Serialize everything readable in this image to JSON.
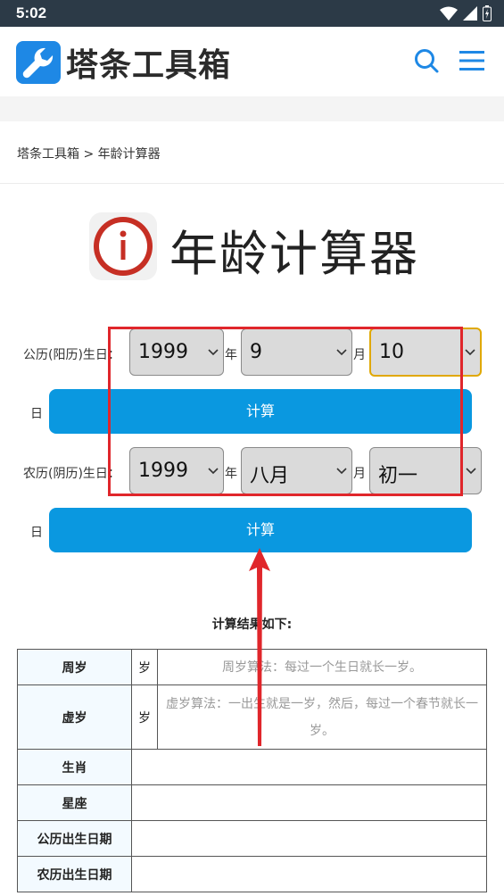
{
  "status": {
    "time": "5:02"
  },
  "header": {
    "logo_text": "塔条工具箱"
  },
  "breadcrumb": {
    "text": "塔条工具箱 > 年龄计算器"
  },
  "page": {
    "title": "年龄计算器"
  },
  "solar": {
    "label": "公历(阳历)生日：",
    "year": "1999",
    "year_unit": "年",
    "month": "9",
    "month_unit": "月",
    "day": "10",
    "day_unit": "日",
    "button": "计算"
  },
  "lunar": {
    "label": "农历(阴历)生日：",
    "year": "1999",
    "year_unit": "年",
    "month": "八月",
    "month_unit": "月",
    "day": "初一",
    "day_unit": "日",
    "button": "计算"
  },
  "results": {
    "title": "计算结果如下:",
    "rows": [
      {
        "key": "周岁",
        "unit": "岁",
        "desc": "周岁算法：每过一个生日就长一岁。"
      },
      {
        "key": "虚岁",
        "unit": "岁",
        "desc": "虚岁算法：一出生就是一岁，然后，每过一个春节就长一岁。"
      },
      {
        "key": "生肖",
        "unit": "",
        "desc": ""
      },
      {
        "key": "星座",
        "unit": "",
        "desc": ""
      },
      {
        "key": "公历出生日期",
        "unit": "",
        "desc": ""
      },
      {
        "key": "农历出生日期",
        "unit": "",
        "desc": ""
      }
    ]
  },
  "colors": {
    "accent": "#0a98e0",
    "annotation": "#e0262b",
    "statusbar": "#2c3a47",
    "logo_blue": "#1e88e5"
  }
}
